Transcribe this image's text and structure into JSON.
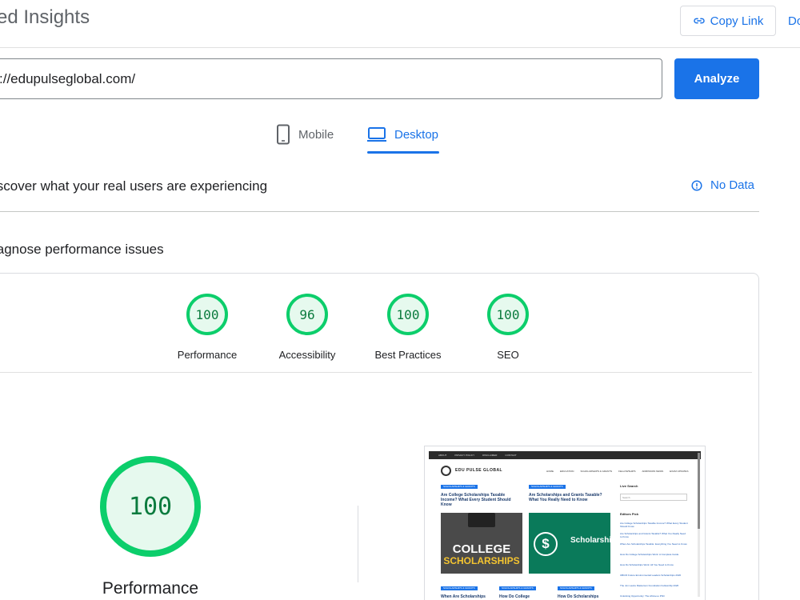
{
  "header": {
    "title": "ed Insights",
    "copy_link": "Copy Link",
    "docs": "Do"
  },
  "search": {
    "url_value": "://edupulseglobal.com/",
    "analyze_label": "Analyze"
  },
  "tabs": [
    {
      "label": "Mobile",
      "selected": false
    },
    {
      "label": "Desktop",
      "selected": true
    }
  ],
  "crux": {
    "heading": "iscover what your real users are experiencing",
    "status": "No Data"
  },
  "diagnose": {
    "heading": "iagnose performance issues"
  },
  "scores": [
    {
      "value": "100",
      "label": "Performance"
    },
    {
      "value": "96",
      "label": "Accessibility"
    },
    {
      "value": "100",
      "label": "Best Practices"
    },
    {
      "value": "100",
      "label": "SEO"
    }
  ],
  "main_score": {
    "value": "100",
    "label": "Performance"
  },
  "colors": {
    "accent": "#1a73e8",
    "pass": "#0cce6b",
    "pass_fill": "#e6f9ee"
  },
  "thumbnail": {
    "topbar": [
      "ABOUT",
      "PRIVACY POLICY",
      "DISCLAIMER",
      "CONTACT"
    ],
    "logo": "EDU PULSE GLOBAL",
    "nav": [
      "HOME",
      "EDUCATION",
      "SCHOLARSHIPS & GRANTS",
      "FELLOWSHIPS",
      "ADMISSION NEWS",
      "EXAM UPDATES"
    ],
    "tag": "SCHOLARSHIPS & GRANTS",
    "post1_title": "Are College Scholarships Taxable Income? What Every Student Should Know",
    "post2_title": "Are Scholarships and Grants Taxable? What You Really Need to Know",
    "img1_text_1": "COLLEGE",
    "img1_text_2": "SCHOLARSHIPS",
    "img2_text": "Scholarshi and Gran",
    "post3_title": "When Are Scholarships",
    "post4_title": "How Do College",
    "post5_title": "How Do Scholarships",
    "live_search": "Live Search",
    "search_placeholder": "Search",
    "editors_pick": "Editors Pick",
    "links": [
      "Are College Scholarships Taxable Income? What Every Student Should Know",
      "Are Scholarships and Grants Taxable? What You Really Need to Know",
      "When Are Scholarships Taxable: Everything You Need to Know",
      "How Do College Scholarships Work: A Complete Guide",
      "How Do Scholarships Work: All You Need to Know",
      "UBC/D Future Environmental Leaders Scholarships 2026",
      "The Jon Laurie Masterson Foundation Fellowship 2026",
      "Unlocking Opportunity: The Africa-Lu PhD"
    ]
  }
}
